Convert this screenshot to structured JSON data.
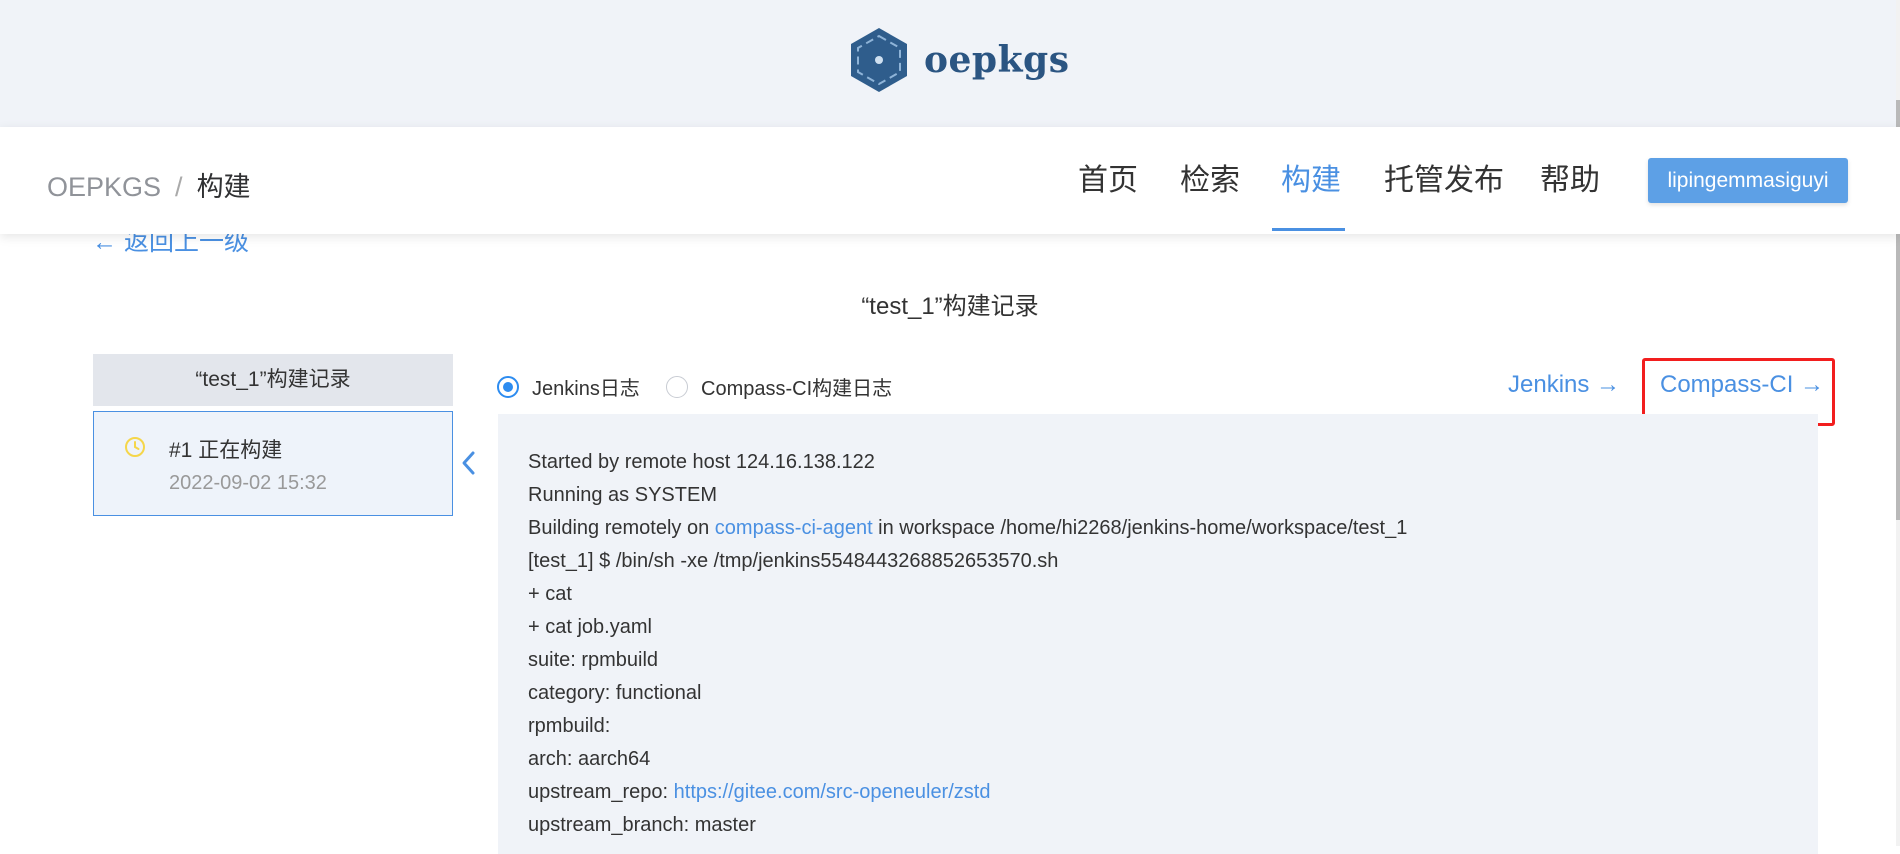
{
  "brand": {
    "name": "oepkgs"
  },
  "breadcrumb": {
    "root": "OEPKGS",
    "separator": "/",
    "current": "构建"
  },
  "nav": {
    "items": [
      {
        "label": "首页",
        "active": false
      },
      {
        "label": "检索",
        "active": false
      },
      {
        "label": "构建",
        "active": true
      },
      {
        "label": "托管发布",
        "active": false
      },
      {
        "label": "帮助",
        "active": false
      }
    ],
    "user": "lipingemmasiguyi"
  },
  "back_link": "← 返回上一级",
  "page_title": "“test_1”构建记录",
  "sidebar": {
    "header": "“test_1”构建记录",
    "items": [
      {
        "title": "#1 正在构建",
        "time": "2022-09-02 15:32",
        "status_icon": "clock-icon"
      }
    ]
  },
  "log_tabs": [
    {
      "label": "Jenkins日志",
      "selected": true
    },
    {
      "label": "Compass-CI构建日志",
      "selected": false
    }
  ],
  "links": {
    "jenkins": "Jenkins →",
    "compass": "Compass-CI →"
  },
  "log": {
    "lines": [
      "Started by remote host 124.16.138.122",
      "Running as SYSTEM",
      "+ cat",
      "+ cat job.yaml",
      "suite: rpmbuild",
      "category: functional",
      "rpmbuild:",
      "arch: aarch64",
      "upstream_branch: master"
    ],
    "building_prefix": "Building remotely on ",
    "agent_link": "compass-ci-agent",
    "building_suffix": " in workspace /home/hi2268/jenkins-home/workspace/test_1",
    "shell_line": "[test_1] $ /bin/sh -xe /tmp/jenkins5548443268852653570.sh",
    "repo_prefix": "upstream_repo: ",
    "repo_link": "https://gitee.com/src-openeuler/zstd"
  },
  "colors": {
    "accent": "#4a90e2",
    "highlight": "#f21e1e",
    "panel": "#f0f3f8"
  }
}
